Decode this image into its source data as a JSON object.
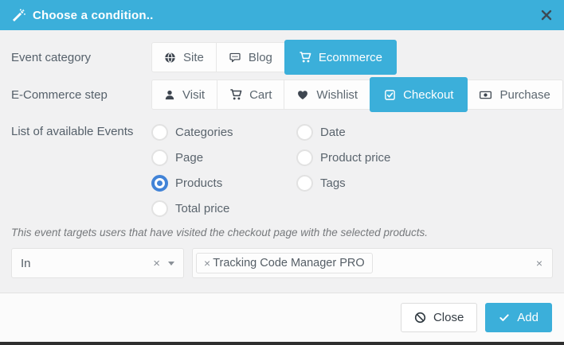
{
  "modal": {
    "title": "Choose a condition..",
    "header_icon": "magic-wand-icon",
    "close_icon": "close-icon"
  },
  "event_category": {
    "label": "Event category",
    "buttons": [
      {
        "label": "Site",
        "icon": "globe-icon",
        "selected": false
      },
      {
        "label": "Blog",
        "icon": "comment-icon",
        "selected": false
      },
      {
        "label": "Ecommerce",
        "icon": "shopping-cart-icon",
        "selected": true
      }
    ]
  },
  "ecommerce_step": {
    "label": "E-Commerce step",
    "buttons": [
      {
        "label": "Visit",
        "icon": "user-icon",
        "selected": false
      },
      {
        "label": "Cart",
        "icon": "shopping-cart-icon",
        "selected": false
      },
      {
        "label": "Wishlist",
        "icon": "heart-icon",
        "selected": false
      },
      {
        "label": "Checkout",
        "icon": "check-square-icon",
        "selected": true
      },
      {
        "label": "Purchase",
        "icon": "money-icon",
        "selected": false
      }
    ]
  },
  "events": {
    "label": "List of available Events",
    "left": [
      "Categories",
      "Page",
      "Products",
      "Total price"
    ],
    "right": [
      "Date",
      "Product price",
      "Tags"
    ],
    "selected": "Products"
  },
  "note": "This event targets users that have visited the checkout page with the selected products.",
  "condition": {
    "operator": {
      "value": "In",
      "clear_symbol": "×"
    },
    "tags": [
      "Tracking Code Manager PRO"
    ],
    "tag_remove_symbol": "×",
    "clear_symbol": "×"
  },
  "footer": {
    "close_label": "Close",
    "add_label": "Add"
  },
  "colors": {
    "accent_blue": "#3bafda",
    "radio_selected_blue": "#4183d7",
    "body_background": "#f1f1f2",
    "footer_background": "#fbfbfb"
  }
}
